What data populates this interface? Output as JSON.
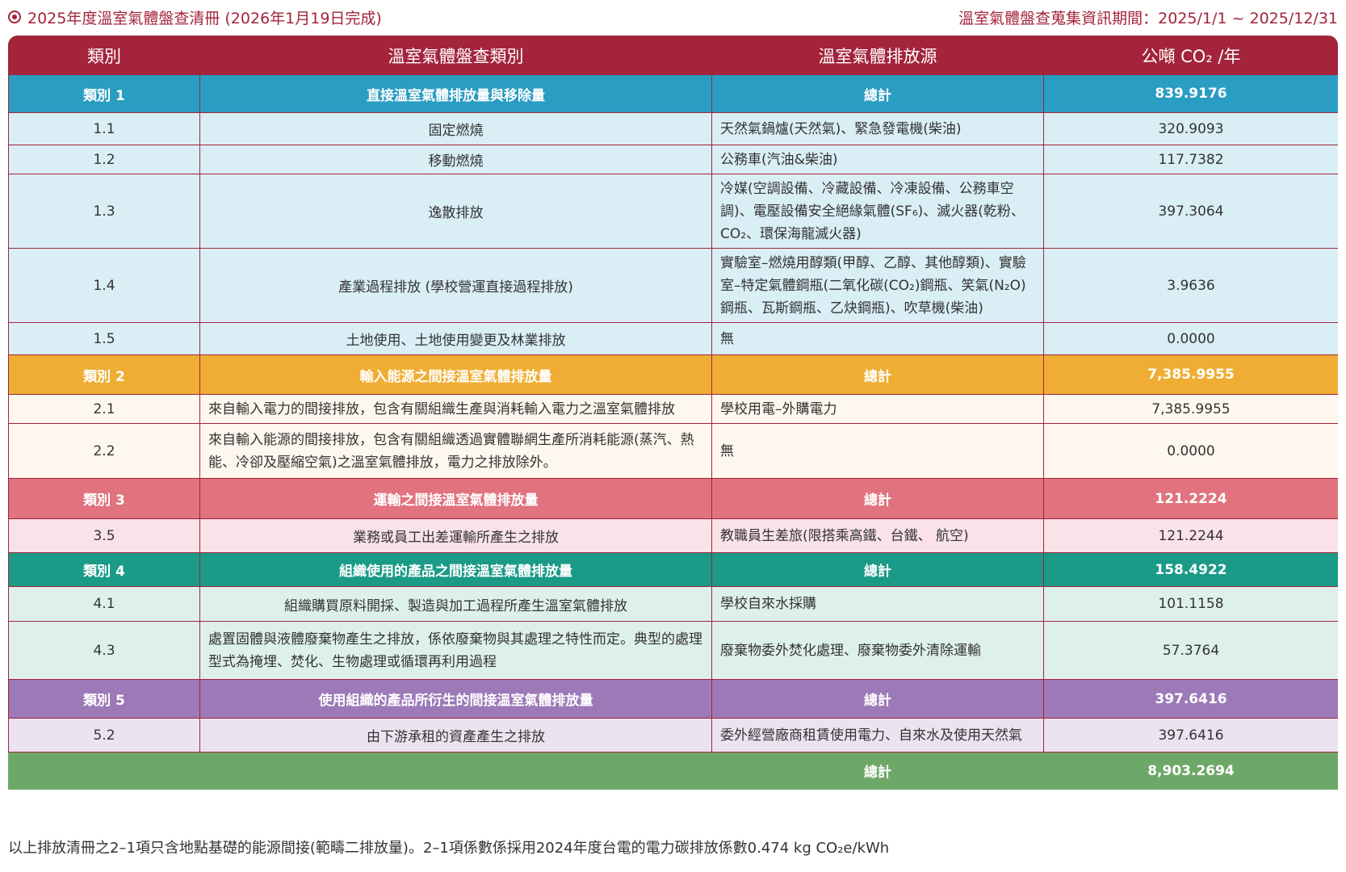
{
  "header": {
    "title": "2025年度溫室氣體盤查清冊 (2026年1月19日完成)",
    "period": "溫室氣體盤查蒐集資訊期間：2025/1/1 ~ 2025/12/31"
  },
  "columns": [
    "類別",
    "溫室氣體盤查類別",
    "溫室氣體排放源",
    "公噸 CO₂ /年"
  ],
  "categories": [
    {
      "label": "類別 1",
      "name": "直接溫室氣體排放量與移除量",
      "total_label": "總計",
      "total": "839.9176",
      "rows": [
        {
          "id": "1.1",
          "desc": "固定燃燒",
          "source": "天然氣鍋爐(天然氣)、緊急發電機(柴油)",
          "value": "320.9093"
        },
        {
          "id": "1.2",
          "desc": "移動燃燒",
          "source": "公務車(汽油&柴油)",
          "value": "117.7382"
        },
        {
          "id": "1.3",
          "desc": "逸散排放",
          "source": "冷媒(空調設備、冷藏設備、冷凍設備、公務車空調)、電壓設備安全絕緣氣體(SF₆)、滅火器(乾粉、CO₂、環保海龍滅火器)",
          "value": "397.3064"
        },
        {
          "id": "1.4",
          "desc": "產業過程排放 (學校營運直接過程排放)",
          "source": "實驗室–燃燒用醇類(甲醇、乙醇、其他醇類)、實驗室–特定氣體鋼瓶(二氧化碳(CO₂)鋼瓶、笑氣(N₂O)鋼瓶、瓦斯鋼瓶、乙炔鋼瓶)、吹草機(柴油)",
          "value": "3.9636"
        },
        {
          "id": "1.5",
          "desc": "土地使用、土地使用變更及林業排放",
          "source": "無",
          "value": "0.0000"
        }
      ]
    },
    {
      "label": "類別 2",
      "name": "輸入能源之間接溫室氣體排放量",
      "total_label": "總計",
      "total": "7,385.9955",
      "rows": [
        {
          "id": "2.1",
          "desc": "來自輸入電力的間接排放，包含有關組織生產與消耗輸入電力之溫室氣體排放",
          "source": "學校用電–外購電力",
          "value": "7,385.9955"
        },
        {
          "id": "2.2",
          "desc": "來自輸入能源的間接排放，包含有關組織透過實體聯網生產所消耗能源(蒸汽、熱能、冷卻及壓縮空氣)之溫室氣體排放，電力之排放除外。",
          "source": "無",
          "value": "0.0000"
        }
      ]
    },
    {
      "label": "類別 3",
      "name": "運輸之間接溫室氣體排放量",
      "total_label": "總計",
      "total": "121.2224",
      "rows": [
        {
          "id": "3.5",
          "desc": "業務或員工出差運輸所產生之排放",
          "source": "教職員生差旅(限搭乘高鐵、台鐵、 航空)",
          "value": "121.2244"
        }
      ]
    },
    {
      "label": "類別 4",
      "name": "組織使用的產品之間接溫室氣體排放量",
      "total_label": "總計",
      "total": "158.4922",
      "rows": [
        {
          "id": "4.1",
          "desc": "組織購買原料開採、製造與加工過程所產生溫室氣體排放",
          "source": "學校自來水採購",
          "value": "101.1158"
        },
        {
          "id": "4.3",
          "desc": "處置固體與液體廢棄物產生之排放，係依廢棄物與其處理之特性而定。典型的處理型式為掩埋、焚化、生物處理或循環再利用過程",
          "source": "廢棄物委外焚化處理、廢棄物委外清除運輸",
          "value": "57.3764"
        }
      ]
    },
    {
      "label": "類別 5",
      "name": "使用組織的產品所衍生的間接溫室氣體排放量",
      "total_label": "總計",
      "total": "397.6416",
      "rows": [
        {
          "id": "5.2",
          "desc": "由下游承租的資產產生之排放",
          "source": "委外經營廠商租賃使用電力、自來水及使用天然氣",
          "value": "397.6416"
        }
      ]
    }
  ],
  "grand_total": {
    "label": "總計",
    "value": "8,903.2694"
  },
  "footnote": "以上排放清冊之2–1項只含地點基礎的能源間接(範疇二排放量)。2–1項係數係採用2024年度台電的電力碳排放係數0.474 kg CO₂e/kWh",
  "colors": {
    "header": "#a3243b",
    "cat1": "#2a9dc2",
    "cat1_light": "#d9eef5",
    "cat2": "#efae33",
    "cat2_light": "#fdf7ee",
    "cat3": "#e0737e",
    "cat3_light": "#f9e2e8",
    "cat4": "#1a9a87",
    "cat4_light": "#def0ec",
    "cat5": "#9d79b8",
    "cat5_light": "#ebe3f0",
    "total": "#6ea868"
  }
}
